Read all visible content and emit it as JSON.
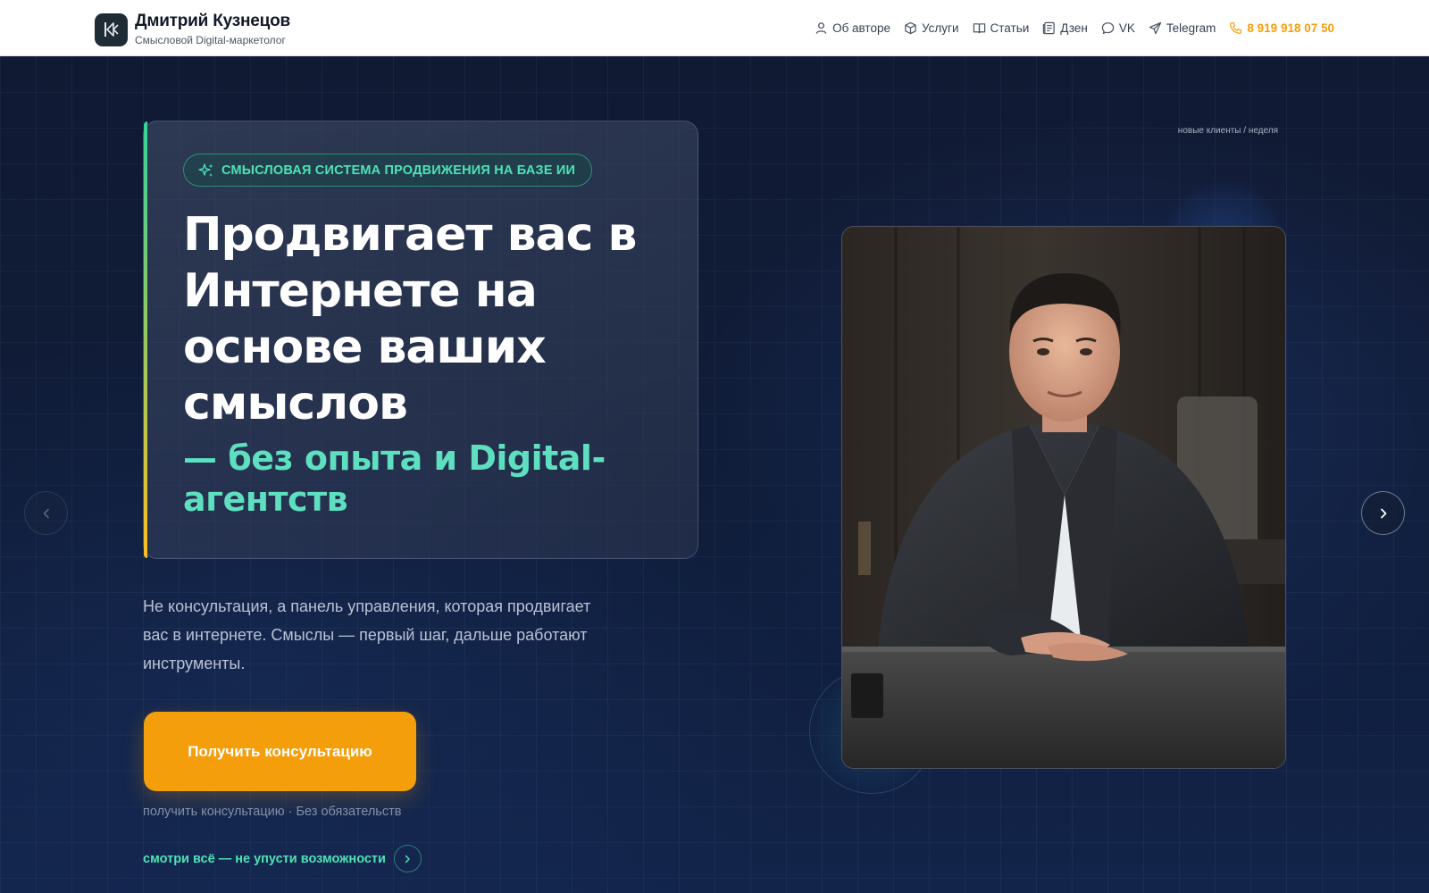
{
  "header": {
    "brand_name": "Дмитрий Кузнецов",
    "brand_subtitle": "Смысловой Digital-маркетолог",
    "nav": [
      {
        "label": "Об авторе",
        "icon": "user-icon"
      },
      {
        "label": "Услуги",
        "icon": "box-icon"
      },
      {
        "label": "Статьи",
        "icon": "book-icon"
      },
      {
        "label": "Дзен",
        "icon": "newspaper-icon"
      },
      {
        "label": "VK",
        "icon": "chat-bubble-icon"
      },
      {
        "label": "Telegram",
        "icon": "send-icon"
      }
    ],
    "phone": "8 919 918 07 50",
    "phone_icon": "phone-icon"
  },
  "hero": {
    "badge": "СМЫСЛОВАЯ СИСТЕМА ПРОДВИЖЕНИЯ НА БАЗЕ ИИ",
    "badge_icon": "sparkles-icon",
    "headline": "Продвигает вас в Интернете на основе ваших смыслов",
    "subheadline": "— без опыта и Digital-агентств",
    "lead": "Не консультация, а панель управления, которая продвигает вас в интернете. Смыслы — первый шаг, дальше работают инструменты.",
    "cta_label": "Получить консультацию",
    "cta_note": "получить консультацию · Без обязательств",
    "see_all": "смотри всё — не упусти возможности",
    "stat_label": "новые клиенты / неделя"
  },
  "colors": {
    "accent_orange": "#f59e0b",
    "accent_teal": "#4ee3b6",
    "hero_bg": "#111a33"
  }
}
